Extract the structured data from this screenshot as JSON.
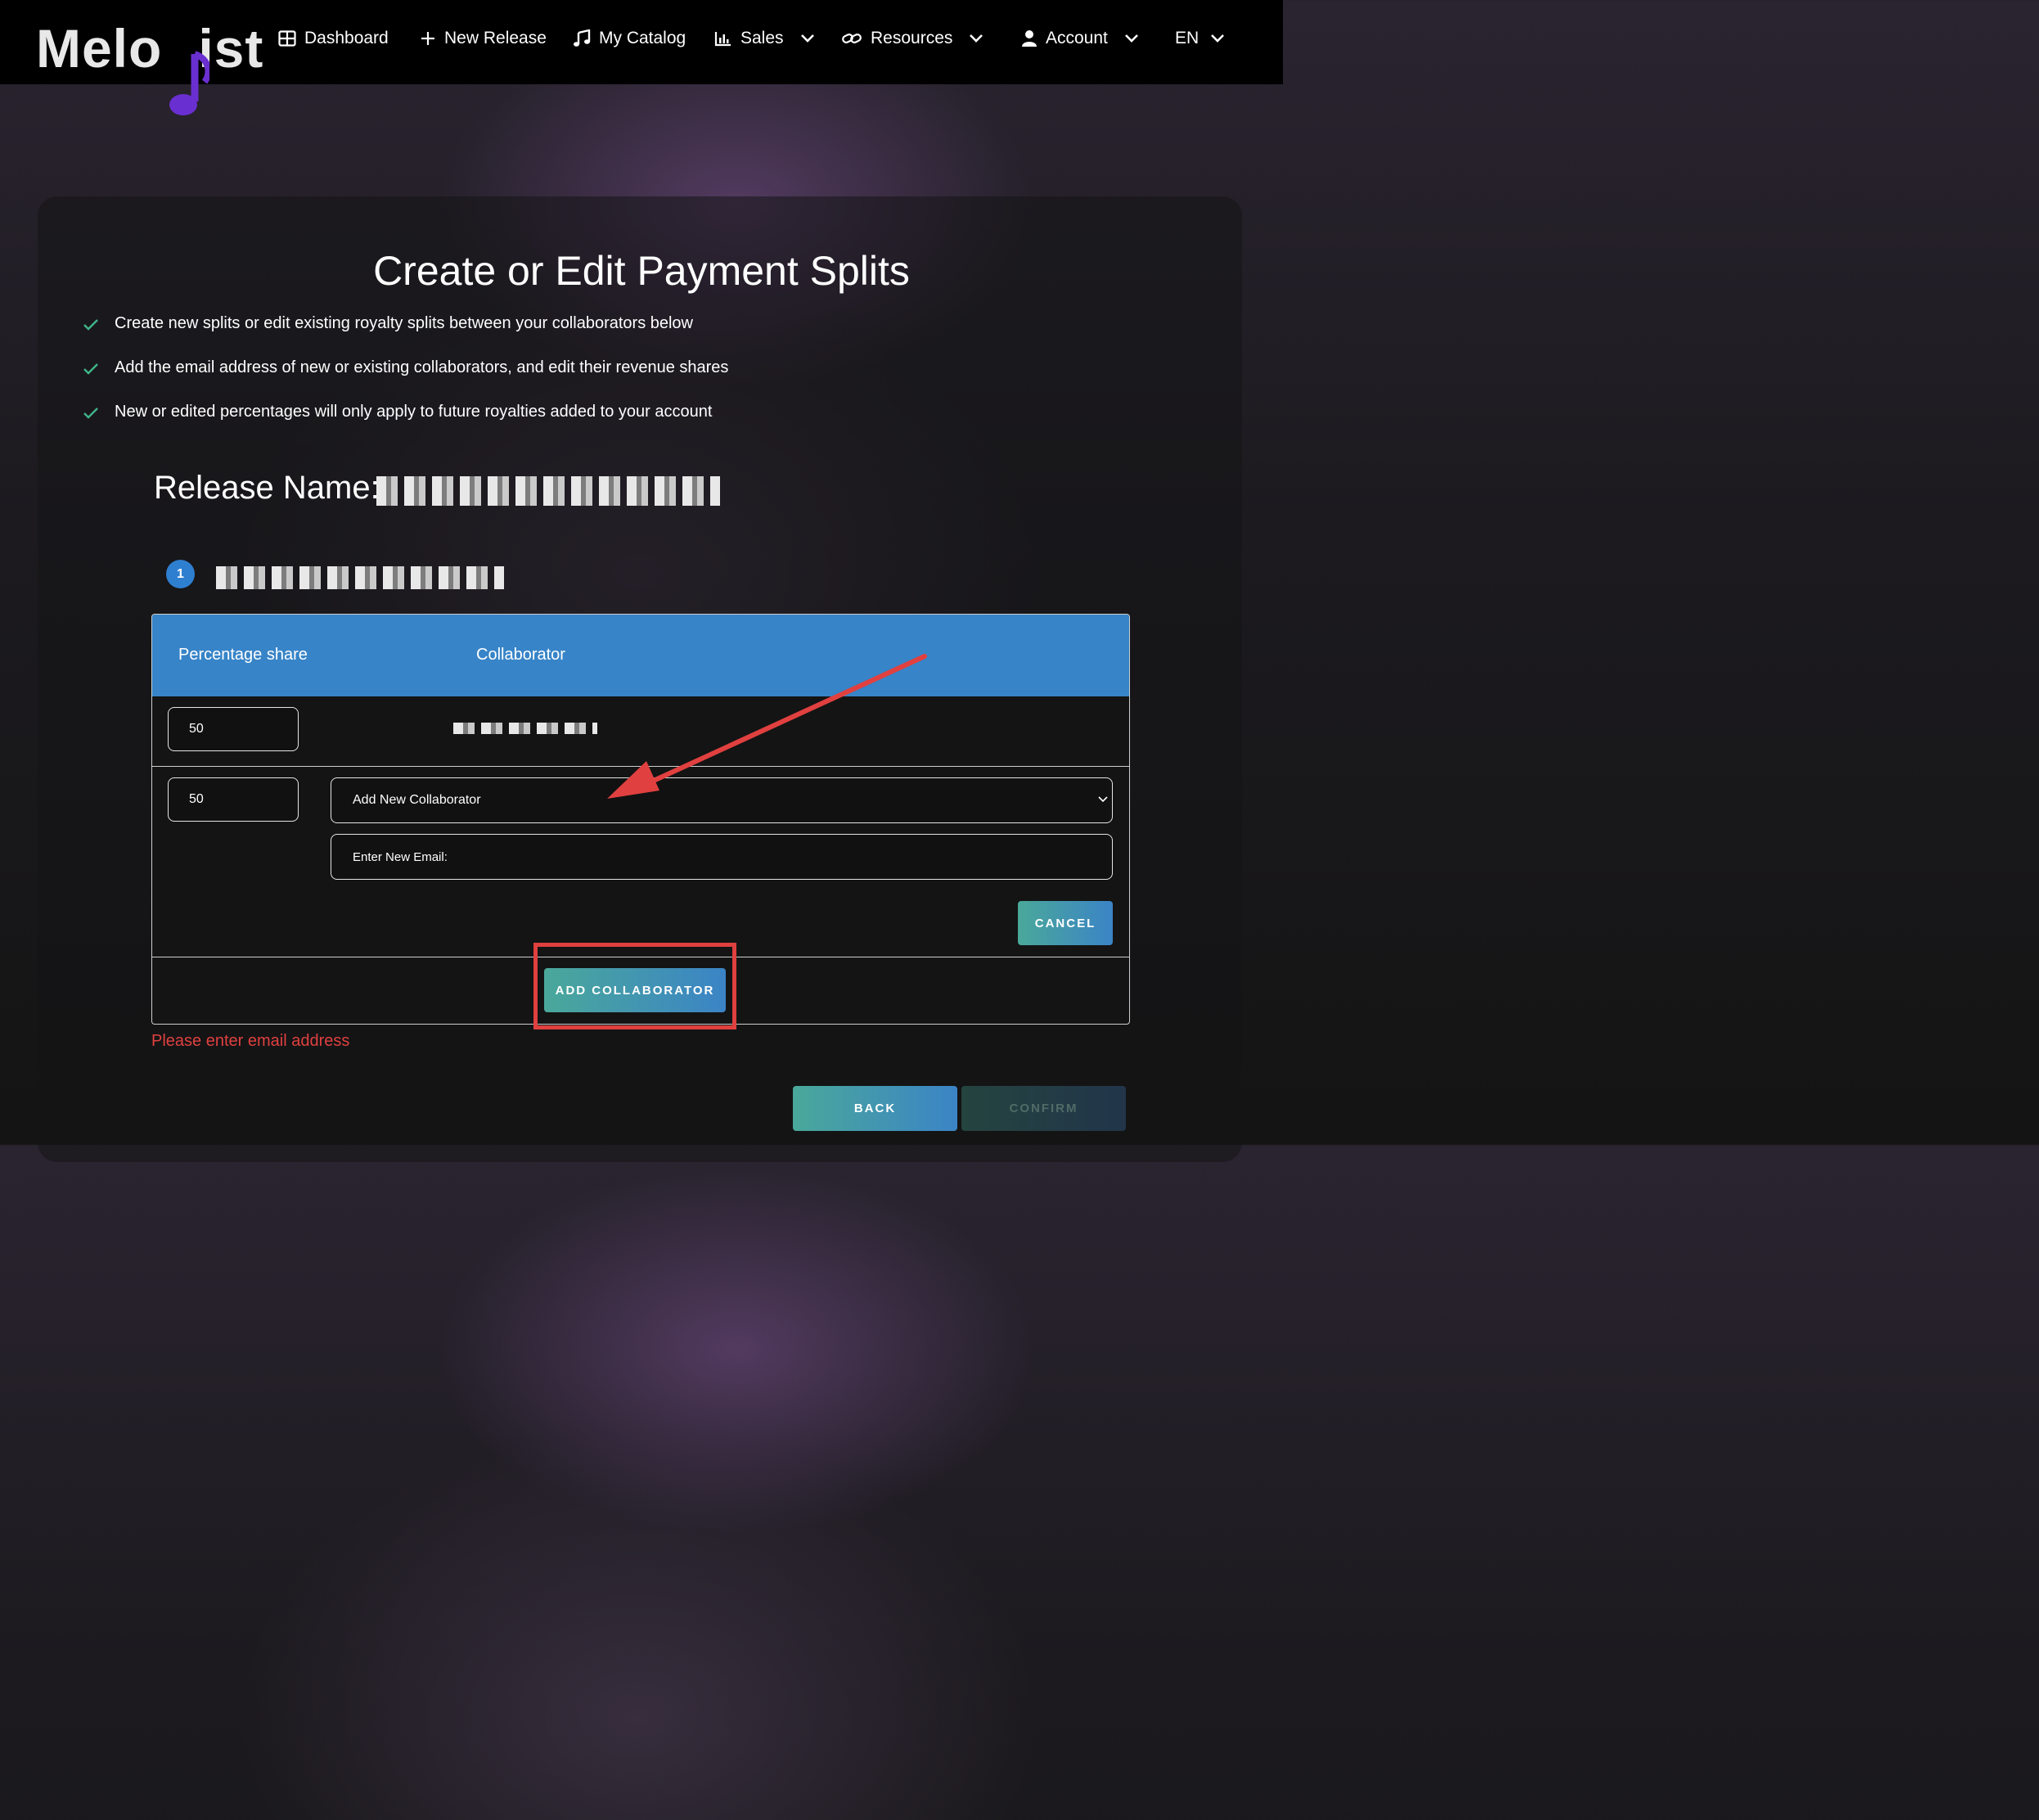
{
  "brand": {
    "logo_left": "Melo",
    "logo_right": "ist",
    "accent_color": "#6a2fd0"
  },
  "nav": {
    "items": [
      {
        "label": "Dashboard",
        "icon": "grid-icon"
      },
      {
        "label": "New Release",
        "icon": "plus-icon"
      },
      {
        "label": "My Catalog",
        "icon": "music-note-icon"
      },
      {
        "label": "Sales",
        "icon": "bar-chart-icon",
        "dropdown": true
      },
      {
        "label": "Resources",
        "icon": "link-icon",
        "dropdown": true
      },
      {
        "label": "Account",
        "icon": "user-icon",
        "dropdown": true
      },
      {
        "label": "EN",
        "dropdown": true
      }
    ]
  },
  "page": {
    "title": "Create or Edit Payment Splits",
    "bullets": [
      "Create new splits or edit existing royalty splits between your collaborators below",
      "Add the email address of new or existing collaborators, and edit their revenue shares",
      "New or edited percentages will only apply to future royalties added to your account"
    ],
    "release_label": "Release Name:",
    "step_number": "1"
  },
  "table": {
    "header_pct": "Percentage share",
    "header_collab": "Collaborator",
    "rows": [
      {
        "percentage": "50"
      },
      {
        "percentage": "50",
        "select_value": "Add New Collaborator",
        "email_placeholder": "Enter New Email:"
      }
    ],
    "cancel_label": "CANCEL",
    "add_label": "ADD COLLABORATOR"
  },
  "error_text": "Please enter email address",
  "footer": {
    "back_label": "BACK",
    "confirm_label": "CONFIRM"
  },
  "colors": {
    "header_blue": "#3784c8",
    "error_red": "#e0403f",
    "check_green": "#3fb58a"
  }
}
